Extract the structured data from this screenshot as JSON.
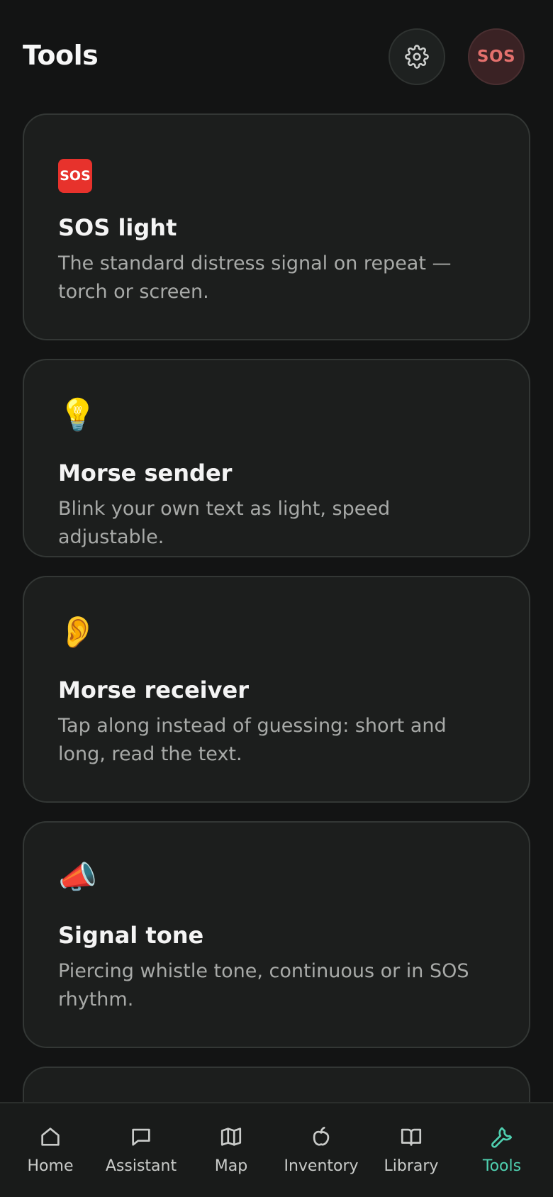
{
  "header": {
    "title": "Tools",
    "settings_icon": "gear-icon",
    "sos_label": "SOS"
  },
  "tools": [
    {
      "icon": "sos-emoji",
      "emoji_text": "SOS",
      "title": "SOS light",
      "description": "The standard distress signal on repeat — torch or screen."
    },
    {
      "icon": "light-bulb-emoji",
      "emoji": "💡",
      "title": "Morse sender",
      "description": "Blink your own text as light, speed adjustable."
    },
    {
      "icon": "ear-emoji",
      "emoji": "👂",
      "title": "Morse receiver",
      "description": "Tap along instead of guessing: short and long, read the text."
    },
    {
      "icon": "megaphone-emoji",
      "emoji": "📣",
      "title": "Signal tone",
      "description": "Piercing whistle tone, continuous or in SOS rhythm."
    }
  ],
  "nav": {
    "items": [
      {
        "label": "Home",
        "icon": "home-icon"
      },
      {
        "label": "Assistant",
        "icon": "chat-icon"
      },
      {
        "label": "Map",
        "icon": "map-icon"
      },
      {
        "label": "Inventory",
        "icon": "apple-icon"
      },
      {
        "label": "Library",
        "icon": "book-icon"
      },
      {
        "label": "Tools",
        "icon": "wrench-icon"
      }
    ],
    "active": "Tools"
  },
  "colors": {
    "background": "#131414",
    "card": "#1c1e1d",
    "accent": "#4fd0b0",
    "sos": "#e4706d"
  }
}
